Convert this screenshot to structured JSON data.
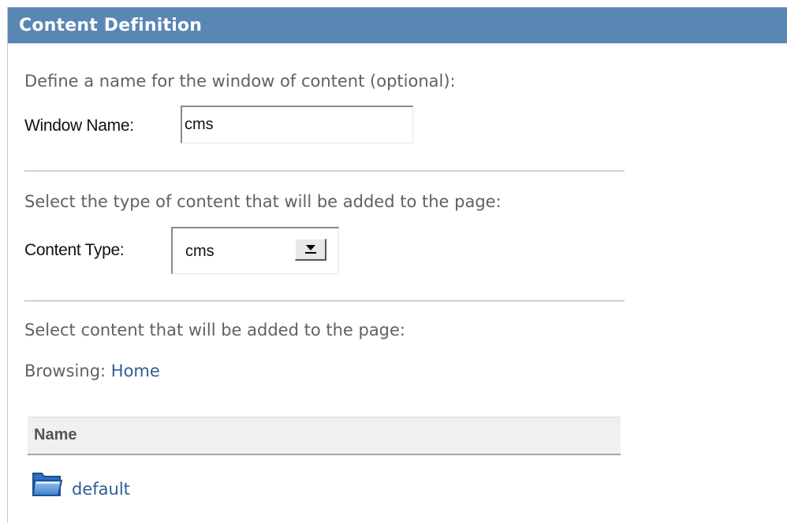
{
  "panel": {
    "title": "Content Definition"
  },
  "window_section": {
    "instruction": "Define a name for the window of content (optional):",
    "label": "Window Name:",
    "value": "cms"
  },
  "type_section": {
    "instruction": "Select the type of content that will be added to the page:",
    "label": "Content Type:",
    "selected": "cms"
  },
  "content_section": {
    "instruction": "Select content that will be added to the page:",
    "browsing_label": "Browsing:",
    "browsing_location": "Home"
  },
  "table": {
    "columns": [
      "Name"
    ],
    "rows": [
      {
        "icon": "folder-icon",
        "name": "default"
      }
    ]
  },
  "colors": {
    "header_bg": "#5a86b4",
    "link": "#2f5d94"
  }
}
